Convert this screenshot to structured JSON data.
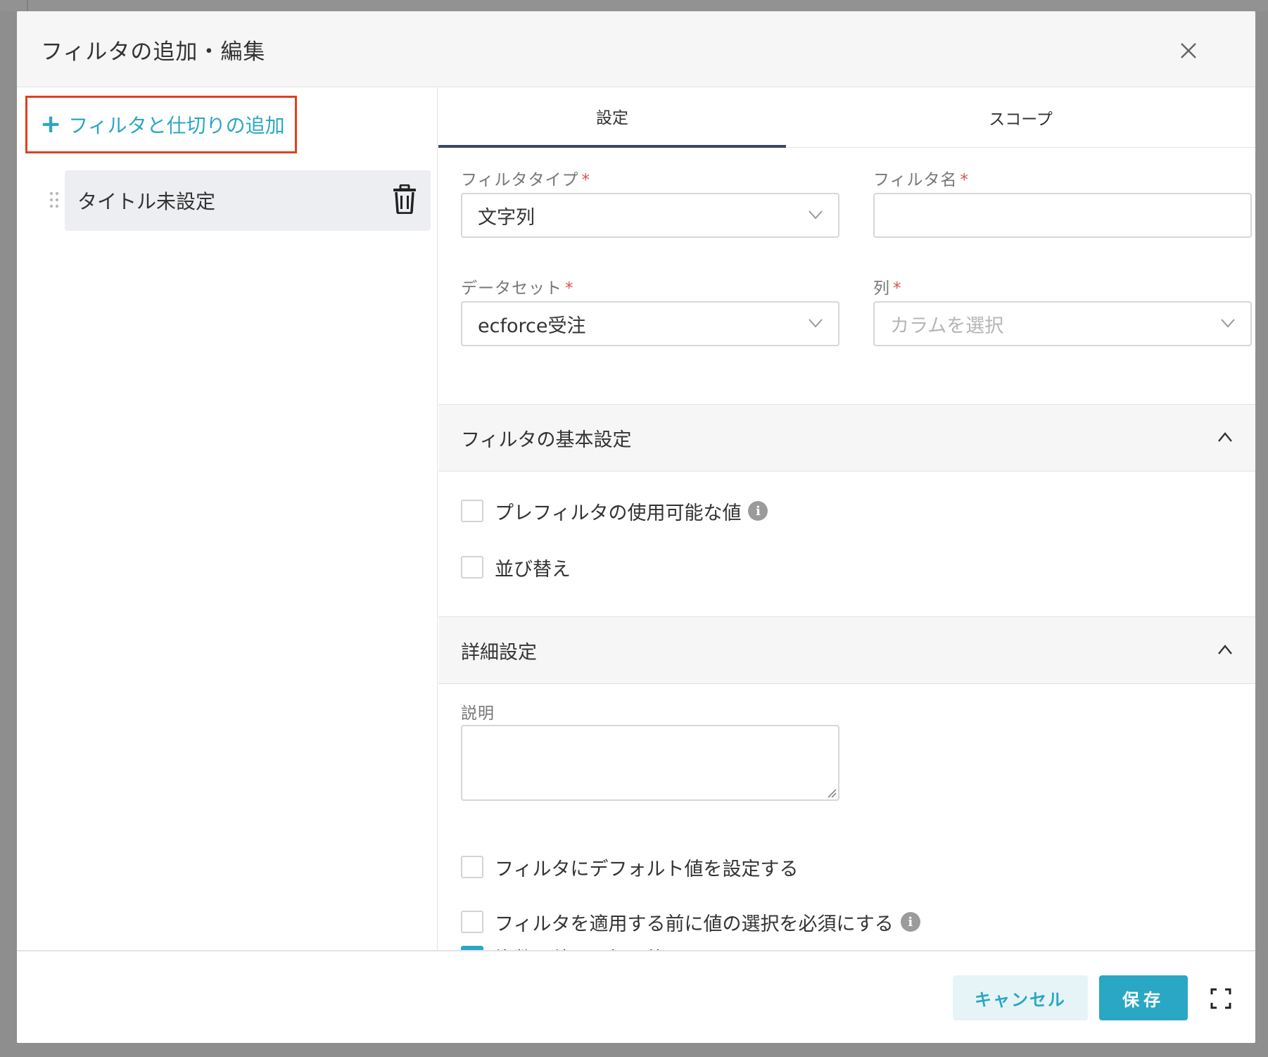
{
  "modal": {
    "title": "フィルタの追加・編集"
  },
  "left": {
    "add_button_label": "フィルタと仕切りの追加",
    "add_button_plus": "+",
    "filter_items": [
      {
        "label": "タイトル未設定"
      }
    ]
  },
  "tabs": [
    {
      "label": "設定",
      "active": true
    },
    {
      "label": "スコープ",
      "active": false
    }
  ],
  "form": {
    "filter_type": {
      "label": "フィルタタイプ",
      "required": "*",
      "value": "文字列"
    },
    "filter_name": {
      "label": "フィルタ名",
      "required": "*",
      "value": ""
    },
    "dataset": {
      "label": "データセット",
      "required": "*",
      "value": "ecforce受注"
    },
    "column": {
      "label": "列",
      "required": "*",
      "placeholder": "カラムを選択"
    }
  },
  "sections": {
    "basic": {
      "title": "フィルタの基本設定",
      "options": [
        {
          "label": "プレフィルタの使用可能な値",
          "checked": false,
          "info": true
        },
        {
          "label": "並び替え",
          "checked": false,
          "info": false
        }
      ]
    },
    "advanced": {
      "title": "詳細設定",
      "description_label": "説明",
      "description_value": "",
      "options": [
        {
          "label": "フィルタにデフォルト値を設定する",
          "checked": false,
          "info": false
        },
        {
          "label": "フィルタを適用する前に値の選択を必須にする",
          "checked": false,
          "info": true
        },
        {
          "label": "複数の値を選択可能にする",
          "checked": true,
          "info": false
        }
      ]
    }
  },
  "footer": {
    "cancel_label": "キャンセル",
    "save_label": "保存"
  },
  "info_glyph": "i",
  "colors": {
    "accent": "#2aa7c4",
    "highlight_border": "#e0401e",
    "tab_indicator": "#3a4660",
    "required": "#d9534f"
  },
  "icons": {
    "close": "close-icon",
    "trash": "trash-icon",
    "drag": "drag-handle-icon",
    "chevron_down": "chevron-down-icon",
    "chevron_up": "chevron-up-icon",
    "info": "info-icon",
    "expand": "expand-icon"
  }
}
